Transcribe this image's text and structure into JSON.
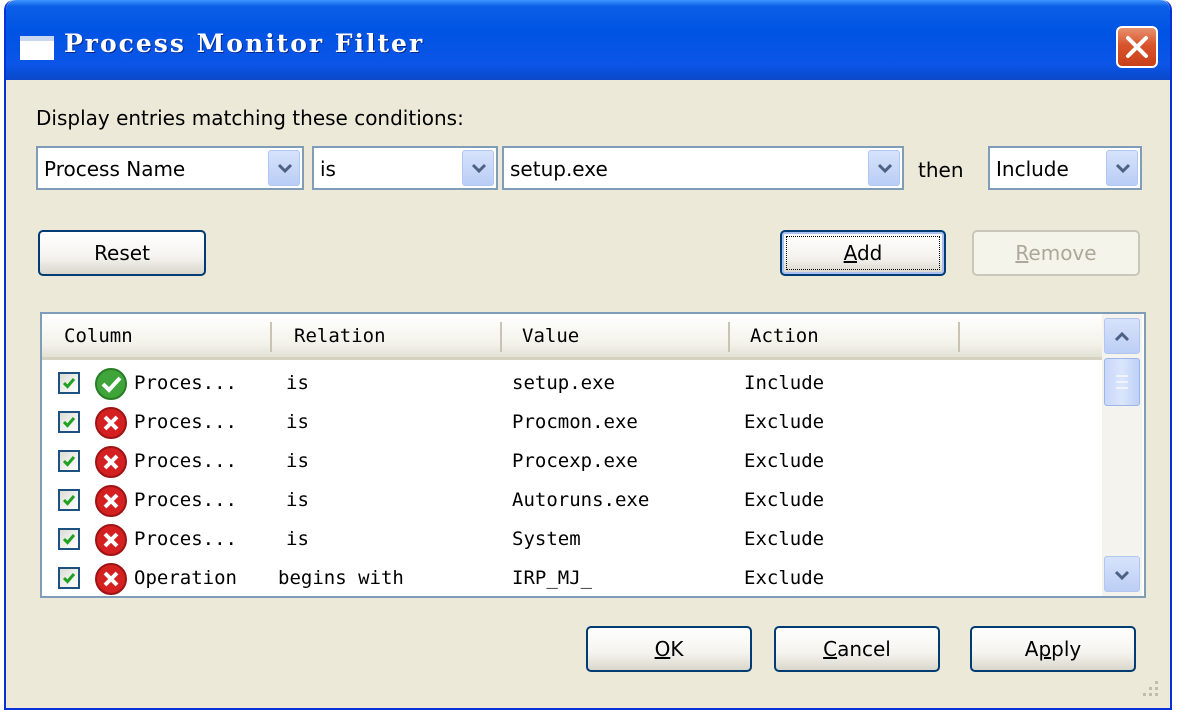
{
  "window": {
    "title": "Process Monitor Filter"
  },
  "conditions": {
    "label": "Display entries matching these conditions:",
    "column_value": "Process Name",
    "relation_value": "is",
    "value_value": "setup.exe",
    "then_label": "then",
    "action_value": "Include"
  },
  "buttons": {
    "reset": "Reset",
    "add_prefix": "",
    "add_underlined": "A",
    "add_suffix": "dd",
    "remove_prefix": "",
    "remove_underlined": "R",
    "remove_suffix": "emove",
    "ok_prefix": "",
    "ok_underlined": "O",
    "ok_suffix": "K",
    "cancel_prefix": "",
    "cancel_underlined": "C",
    "cancel_suffix": "ancel",
    "apply_prefix": "A",
    "apply_underlined": "p",
    "apply_suffix": "ply"
  },
  "table": {
    "columns": [
      "Column",
      "Relation",
      "Value",
      "Action"
    ],
    "rows": [
      {
        "checked": true,
        "status": "include",
        "column": "Proces...",
        "relation": "is",
        "value": "setup.exe",
        "action": "Include"
      },
      {
        "checked": true,
        "status": "exclude",
        "column": "Proces...",
        "relation": "is",
        "value": "Procmon.exe",
        "action": "Exclude"
      },
      {
        "checked": true,
        "status": "exclude",
        "column": "Proces...",
        "relation": "is",
        "value": "Procexp.exe",
        "action": "Exclude"
      },
      {
        "checked": true,
        "status": "exclude",
        "column": "Proces...",
        "relation": "is",
        "value": "Autoruns.exe",
        "action": "Exclude"
      },
      {
        "checked": true,
        "status": "exclude",
        "column": "Proces...",
        "relation": "is",
        "value": "System",
        "action": "Exclude"
      },
      {
        "checked": true,
        "status": "exclude",
        "column": "Operation",
        "relation": "begins with",
        "value": "IRP_MJ_",
        "action": "Exclude"
      }
    ]
  },
  "icons": {
    "window": "window-icon",
    "close": "close-x-icon",
    "include": "green-check-icon",
    "exclude": "red-x-icon",
    "checkbox": "checkmark-icon",
    "dropdown": "chevron-down-icon",
    "scroll_up": "chevron-up-icon",
    "scroll_down": "chevron-down-icon"
  },
  "colors": {
    "titlebar": "#0054e3",
    "dialog_bg": "#ece9d8",
    "close_button": "#d8542b",
    "include_icon": "#3fa53a",
    "exclude_icon": "#d42020"
  }
}
